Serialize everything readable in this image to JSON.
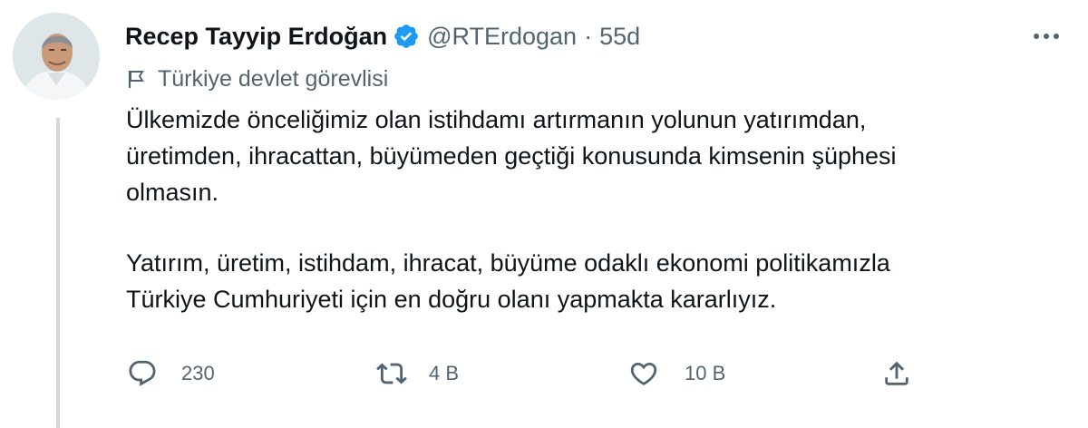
{
  "tweet": {
    "author": {
      "name": "Recep Tayyip Erdoğan",
      "handle": "@RTErdogan",
      "verified": true,
      "avatar_icon": "profile-photo"
    },
    "separator": "·",
    "timestamp": "55d",
    "label": {
      "icon": "flag-icon",
      "text": "Türkiye devlet görevlisi"
    },
    "paragraphs": [
      "Ülkemizde önceliğimiz olan istihdamı artırmanın yolunun yatırımdan,\nüretimden, ihracattan, büyümeden geçtiği konusunda kimsenin şüphesi\nolmasın.",
      "Yatırım, üretim, istihdam, ihracat, büyüme odaklı ekonomi politikamızla\nTürkiye Cumhuriyeti için en doğru olanı yapmakta kararlıyız."
    ],
    "actions": {
      "reply": {
        "icon": "reply-icon",
        "count": "230"
      },
      "retweet": {
        "icon": "retweet-icon",
        "count": "4 B"
      },
      "like": {
        "icon": "heart-icon",
        "count": "10 B"
      },
      "share": {
        "icon": "share-icon"
      }
    },
    "more_icon": "more-icon"
  },
  "colors": {
    "text_primary": "#0f1419",
    "text_secondary": "#536471",
    "verified_blue": "#1d9bf0",
    "thread_line": "#cfd9de"
  }
}
